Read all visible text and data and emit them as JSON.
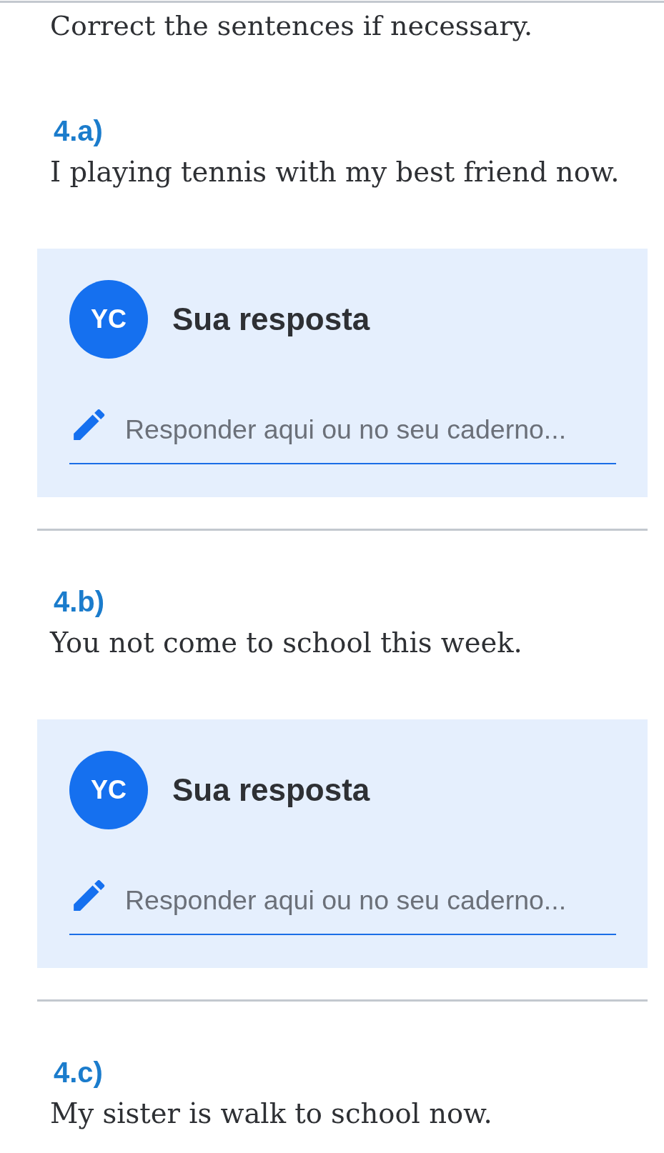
{
  "instruction": "Correct the sentences if necessary.",
  "questions": [
    {
      "label": "4.a)",
      "sentence": "I playing tennis with my best friend now.",
      "answer": {
        "avatar": "YC",
        "title": "Sua resposta",
        "placeholder": "Responder aqui ou no seu caderno..."
      }
    },
    {
      "label": "4.b)",
      "sentence": "You not come to school this week.",
      "answer": {
        "avatar": "YC",
        "title": "Sua resposta",
        "placeholder": "Responder aqui ou no seu caderno..."
      }
    },
    {
      "label": "4.c)",
      "sentence": "My sister is walk to school now."
    }
  ]
}
